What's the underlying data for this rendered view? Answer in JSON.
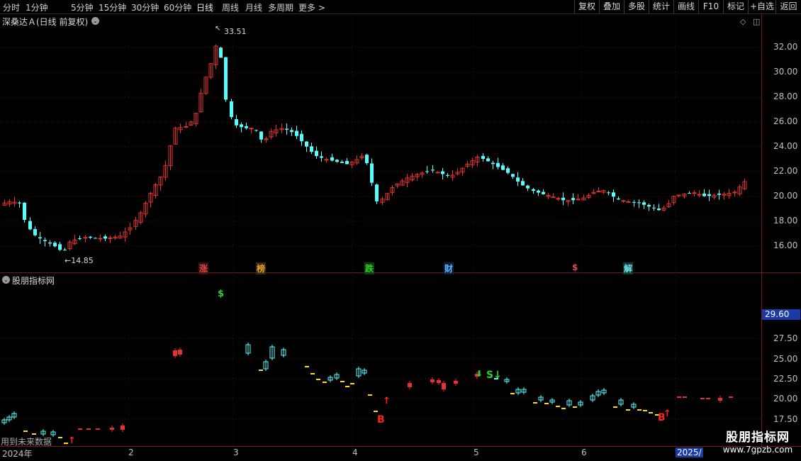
{
  "toolbar": {
    "periods": [
      "分时",
      "1分钟",
      "5分钟",
      "15分钟",
      "30分钟",
      "60分钟",
      "日线",
      "周线",
      "月线",
      "多周期",
      "更多 >"
    ],
    "right_buttons": [
      "复权",
      "叠加",
      "多股",
      "统计",
      "画线",
      "F10",
      "标记",
      "+自选",
      "返回"
    ]
  },
  "main_chart": {
    "title": "深桑达Ａ(日线 前复权)",
    "y_ticks": [
      "32.00",
      "30.00",
      "28.00",
      "26.00",
      "24.00",
      "22.00",
      "20.00",
      "18.00",
      "16.00"
    ],
    "high_label": "33.51",
    "low_label": "←14.85",
    "event_tags": [
      {
        "text": "涨",
        "color": "#e04848"
      },
      {
        "text": "榜",
        "color": "#e0a030"
      },
      {
        "text": "跌",
        "color": "#2ad02a"
      },
      {
        "text": "财",
        "color": "#60b0ff"
      },
      {
        "text": "$",
        "color": "#e04848"
      },
      {
        "text": "解",
        "color": "#70e0e0"
      }
    ],
    "colors": {
      "up": "#e83030",
      "down": "#54ffff",
      "grid": "#6a0a0a"
    }
  },
  "indicator_chart": {
    "title": "股朋指标网",
    "y_ticks": [
      "27.50",
      "25.00",
      "22.50",
      "20.00",
      "17.50"
    ],
    "current_value": "29.60",
    "signals": [
      {
        "text": "$",
        "color": "#2ad02a"
      },
      {
        "text": "S↓",
        "color": "#2ad02a"
      },
      {
        "text": "B",
        "color": "#ff2020"
      },
      {
        "text": "B",
        "color": "#ff2020"
      }
    ],
    "footer_text": "用到未来数据"
  },
  "time_axis": [
    "2024年",
    "2",
    "3",
    "4",
    "5",
    "6",
    "2025/"
  ],
  "watermark": {
    "title": "股朋指标网",
    "url": "www.7gpzb.com"
  }
}
